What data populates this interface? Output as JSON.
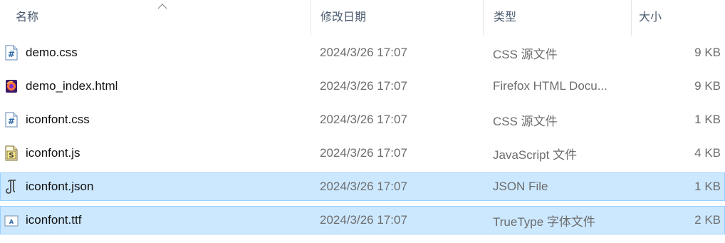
{
  "columns": {
    "name": "名称",
    "date": "修改日期",
    "type": "类型",
    "size": "大小"
  },
  "files": [
    {
      "name": "demo.css",
      "date": "2024/3/26 17:07",
      "type": "CSS 源文件",
      "size": "9 KB",
      "icon": "css-file-icon",
      "selected": false
    },
    {
      "name": "demo_index.html",
      "date": "2024/3/26 17:07",
      "type": "Firefox HTML Docu...",
      "size": "9 KB",
      "icon": "firefox-html-icon",
      "selected": false
    },
    {
      "name": "iconfont.css",
      "date": "2024/3/26 17:07",
      "type": "CSS 源文件",
      "size": "1 KB",
      "icon": "css-file-icon",
      "selected": false
    },
    {
      "name": "iconfont.js",
      "date": "2024/3/26 17:07",
      "type": "JavaScript 文件",
      "size": "4 KB",
      "icon": "js-file-icon",
      "selected": false
    },
    {
      "name": "iconfont.json",
      "date": "2024/3/26 17:07",
      "type": "JSON File",
      "size": "1 KB",
      "icon": "json-file-icon",
      "selected": true
    },
    {
      "name": "iconfont.ttf",
      "date": "2024/3/26 17:07",
      "type": "TrueType 字体文件",
      "size": "2 KB",
      "icon": "font-file-icon",
      "selected": true
    }
  ],
  "colors": {
    "selection_bg": "#cce8ff",
    "selection_border": "#99d1ff",
    "header_text": "#4a5a6e"
  }
}
